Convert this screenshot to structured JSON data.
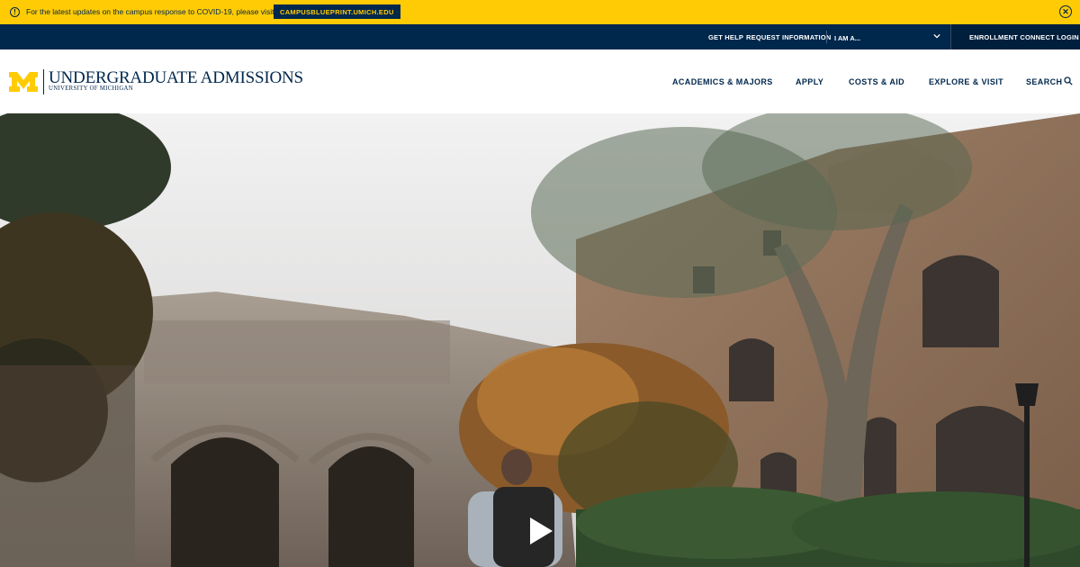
{
  "alert": {
    "icon": "info-icon",
    "text": "For the latest updates on the campus response to COVID-19, please visit",
    "link": "CAMPUSBLUEPRINT.UMICH.EDU",
    "close_icon": "close-icon"
  },
  "utility": {
    "get_help": "GET HELP",
    "request_info": "REQUEST INFORMATION",
    "i_am": "I AM A...",
    "enroll": "ENROLLMENT CONNECT LOGIN"
  },
  "header": {
    "title": "UNDERGRADUATE ADMISSIONS",
    "subtitle": "UNIVERSITY OF MICHIGAN",
    "nav": [
      "ACADEMICS & MAJORS",
      "APPLY",
      "COSTS & AID",
      "EXPLORE & VISIT",
      "SEARCH"
    ]
  },
  "hero": {
    "play_icon": "play-icon"
  },
  "colors": {
    "maize": "#ffcb05",
    "blue": "#00274c"
  }
}
